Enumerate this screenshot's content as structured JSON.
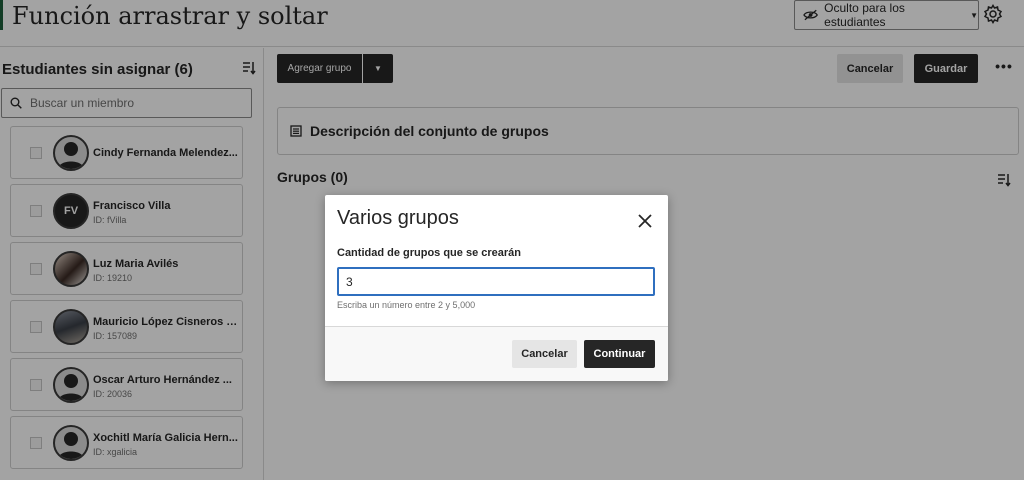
{
  "header": {
    "title": "Función arrastrar y soltar",
    "visibility_label": "Oculto para los estudiantes",
    "icons": {
      "visibility": "eye-slash-icon",
      "settings": "gear-icon"
    }
  },
  "left_panel": {
    "title": "Estudiantes sin asignar (6)",
    "search_placeholder": "Buscar un miembro",
    "students": [
      {
        "name": "Cindy Fernanda Melendez...",
        "id": "",
        "avatar": "silhouette"
      },
      {
        "name": "Francisco Villa",
        "id": "ID: fVilla",
        "avatar": "initials",
        "initials": "FV"
      },
      {
        "name": "Luz Maria Avilés",
        "id": "ID: 19210",
        "avatar": "photo"
      },
      {
        "name": "Mauricio López Cisneros J...",
        "id": "ID: 157089",
        "avatar": "photo"
      },
      {
        "name": "Oscar Arturo Hernández ...",
        "id": "ID: 20036",
        "avatar": "silhouette"
      },
      {
        "name": "Xochitl María Galicia Hern...",
        "id": "ID: xgalicia",
        "avatar": "silhouette"
      }
    ]
  },
  "toolbar": {
    "add_group_label": "Agregar grupo",
    "cancel_label": "Cancelar",
    "save_label": "Guardar",
    "more_label": "•••"
  },
  "main": {
    "description_title": "Descripción del conjunto de grupos",
    "groups_title": "Grupos (0)"
  },
  "modal": {
    "title": "Varios grupos",
    "field_label": "Cantidad de grupos que se crearán",
    "field_value": "3",
    "hint": "Escriba un número entre 2 y 5,000",
    "cancel_label": "Cancelar",
    "continue_label": "Continuar"
  },
  "colors": {
    "brand_accent": "#1d5f3a",
    "primary_button": "#262626",
    "input_focus": "#2f6fbf"
  }
}
